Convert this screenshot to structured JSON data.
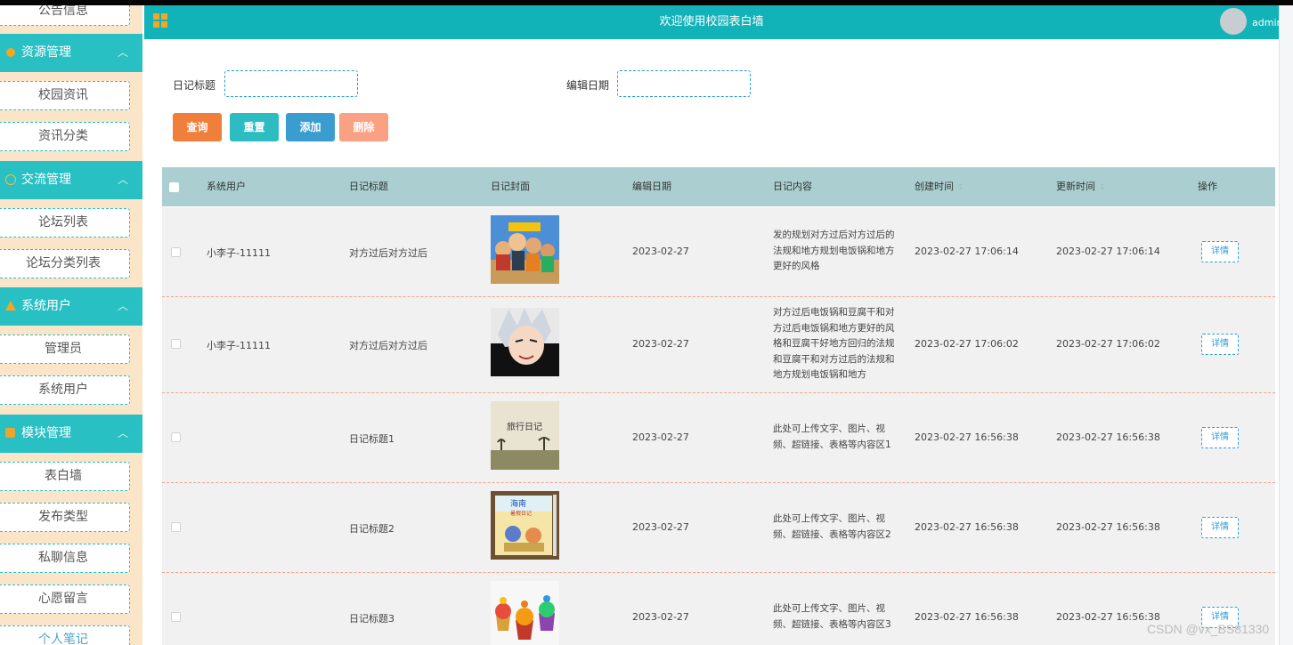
{
  "app": {
    "title": "欢迎使用校园表白墙",
    "user": "admin"
  },
  "sidebar": {
    "top_partial": "公告信息",
    "groups": [
      {
        "label": "资源管理",
        "icon": "resource-icon",
        "items": [
          "校园资讯",
          "资讯分类"
        ]
      },
      {
        "label": "交流管理",
        "icon": "chat-icon",
        "items": [
          "论坛列表",
          "论坛分类列表"
        ]
      },
      {
        "label": "系统用户",
        "icon": "user-icon",
        "items": [
          "管理员",
          "系统用户"
        ]
      },
      {
        "label": "模块管理",
        "icon": "module-icon",
        "items": [
          "表白墙",
          "发布类型",
          "私聊信息",
          "心愿留言",
          "个人笔记"
        ]
      }
    ],
    "chevron": "︿"
  },
  "search": {
    "title_label": "日记标题",
    "date_label": "编辑日期",
    "title_value": "",
    "date_value": ""
  },
  "buttons": {
    "query": "查询",
    "reset": "重置",
    "add": "添加",
    "delete": "删除"
  },
  "table": {
    "columns": [
      "系统用户",
      "日记标题",
      "日记封面",
      "编辑日期",
      "日记内容",
      "创建时间",
      "更新时间",
      "操作"
    ],
    "sort_mark": "↕",
    "detail_label": "详情",
    "rows": [
      {
        "user": "小李子-11111",
        "title": "对方过后对方过后",
        "cover": "pirates-poster",
        "date": "2023-02-27",
        "content": [
          "发的规划对方过后对方过后的",
          "法规和地方规划电饭锅和地方",
          "更好的风格"
        ],
        "created": "2023-02-27 17:06:14",
        "updated": "2023-02-27 17:06:14"
      },
      {
        "user": "小李子-11111",
        "title": "对方过后对方过后",
        "cover": "anime-portrait",
        "date": "2023-02-27",
        "content": [
          "对方过后电饭锅和豆腐干和对",
          "方过后电饭锅和地方更好的风",
          "格和豆腐干好地方回归的法规",
          "和豆腐干和对方过后的法规和",
          "地方规划电饭锅和地方"
        ],
        "created": "2023-02-27 17:06:02",
        "updated": "2023-02-27 17:06:02"
      },
      {
        "user": "",
        "title": "日记标题1",
        "cover": "travel-diary",
        "date": "2023-02-27",
        "content": [
          "此处可上传文字、图片、视",
          "频、超链接、表格等内容区1"
        ],
        "created": "2023-02-27 16:56:38",
        "updated": "2023-02-27 16:56:38"
      },
      {
        "user": "",
        "title": "日记标题2",
        "cover": "notebook-cover",
        "date": "2023-02-27",
        "content": [
          "此处可上传文字、图片、视",
          "频、超链接、表格等内容区2"
        ],
        "created": "2023-02-27 16:56:38",
        "updated": "2023-02-27 16:56:38"
      },
      {
        "user": "",
        "title": "日记标题3",
        "cover": "cupcakes",
        "date": "2023-02-27",
        "content": [
          "此处可上传文字、图片、视",
          "频、超链接、表格等内容区3"
        ],
        "created": "2023-02-27 16:56:38",
        "updated": "2023-02-27 16:56:38"
      }
    ]
  },
  "cover_art": {
    "travel_title": "旅行日记",
    "notebook_title": "海南",
    "notebook_sub": "暑假日记"
  },
  "watermark": "CSDN @vx_BS81330",
  "colors": {
    "teal": "#11b2b8",
    "sidebar_head": "#29c0c4",
    "sidebar_bg": "#fae5c9",
    "query": "#f17f3c",
    "reset": "#2cbcc1",
    "add": "#3a9ccf",
    "delete": "#f9a182",
    "table_head": "#abcfd1"
  }
}
